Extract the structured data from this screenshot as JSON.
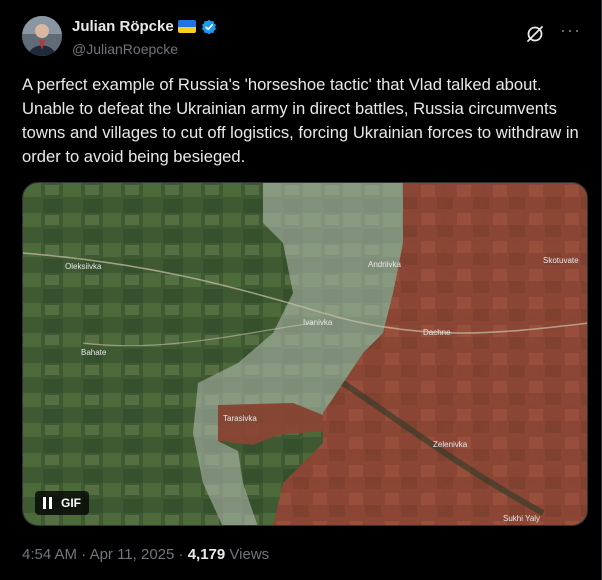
{
  "author": {
    "name": "Julian Röpcke",
    "handle": "@JulianRoepcke",
    "flag_icon": "ukraine-flag-icon",
    "verified_color": "#1d9bf0"
  },
  "tweet": {
    "text": "A perfect example of Russia's 'horseshoe tactic' that Vlad talked about. Unable to defeat the Ukrainian army in direct battles, Russia circumvents towns and villages to cut off logistics, forcing Ukrainian forces to withdraw in order to avoid being besieged."
  },
  "media": {
    "gif_label": "GIF",
    "map_labels": {
      "town1": "Oleksiivka",
      "town2": "Andriivka",
      "town3": "Skotuvate",
      "town4": "Bahate",
      "town5": "Ivanivka",
      "town6": "Dachne",
      "town7": "Zelenivka",
      "town8": "Sukhi Yaly",
      "town9": "Tarasivka"
    },
    "colors": {
      "occupied": "#9a4a3a",
      "contested": "#b8c0b6",
      "terrain": "#3f5a33"
    }
  },
  "meta": {
    "time": "4:54 AM",
    "separator": "·",
    "date": "Apr 11, 2025",
    "views_count": "4,179",
    "views_label": "Views"
  }
}
